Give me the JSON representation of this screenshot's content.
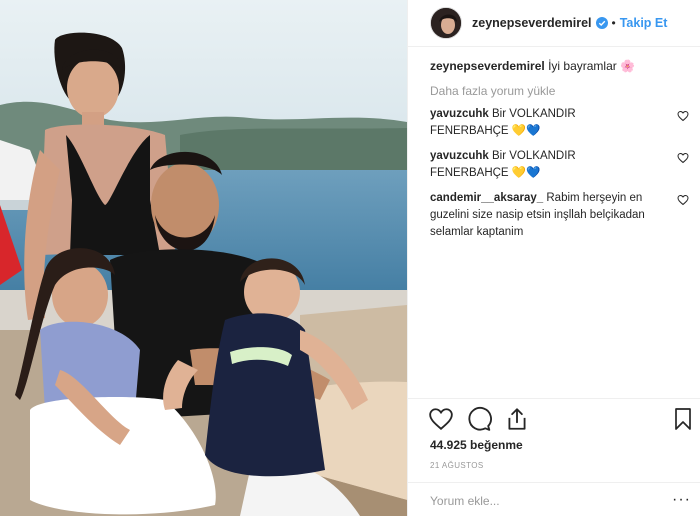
{
  "post": {
    "username": "zeynepseverdemirel",
    "follow_label": "Takip Et",
    "separator": "•",
    "caption_text": "İyi bayramlar 🌸",
    "load_more_label": "Daha fazla yorum yükle",
    "comments": [
      {
        "user": "yavuzcuhk",
        "text": "Bir VOLKANDIR FENERBAHÇE 💛💙"
      },
      {
        "user": "yavuzcuhk",
        "text": "Bir VOLKANDIR FENERBAHÇE 💛💙"
      },
      {
        "user": "candemir__aksaray_",
        "text": "Rabim herşeyin en guzelini size nasip etsin inşllah belçikadan selamlar kaptanim"
      }
    ],
    "likes_label": "44.925 beğenme",
    "date_label": "21 AĞUSTOS",
    "comment_placeholder": "Yorum ekle...",
    "more_label": "···"
  },
  "icons": {
    "verified": "verified-badge-icon",
    "like": "heart-icon",
    "comment": "comment-bubble-icon",
    "share": "share-icon",
    "save": "bookmark-icon",
    "comment_like": "heart-icon"
  },
  "colors": {
    "link_blue": "#3897f0",
    "muted_gray": "#999999",
    "text": "#262626",
    "border": "#efefef"
  }
}
